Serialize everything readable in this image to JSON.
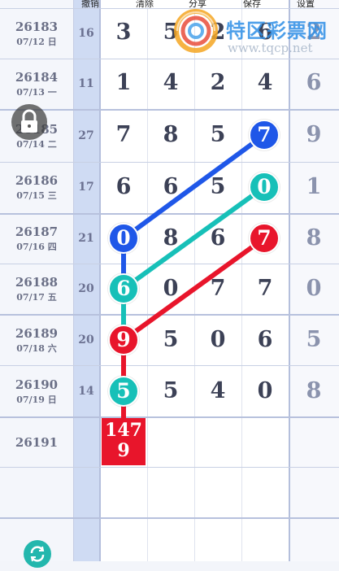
{
  "toolbar": {
    "undo_label": "撤销",
    "clear_label": "清除",
    "share_label": "分享",
    "save_label": "保存",
    "settings_label": "设置"
  },
  "watermark": {
    "title": "特区彩票网",
    "url": "www.tqcp.net"
  },
  "rows": [
    {
      "issue": "26183",
      "date": "07/12 日",
      "sum": "16",
      "digits": [
        "3",
        "5",
        "2",
        "6"
      ],
      "extra": "2"
    },
    {
      "issue": "26184",
      "date": "07/13 一",
      "sum": "11",
      "digits": [
        "1",
        "4",
        "2",
        "4"
      ],
      "extra": "6"
    },
    {
      "issue": "26185",
      "date": "07/14 二",
      "sum": "27",
      "digits": [
        "7",
        "8",
        "5",
        "7"
      ],
      "extra": "9"
    },
    {
      "issue": "26186",
      "date": "07/15 三",
      "sum": "17",
      "digits": [
        "6",
        "6",
        "5",
        "0"
      ],
      "extra": "1"
    },
    {
      "issue": "26187",
      "date": "07/16 四",
      "sum": "21",
      "digits": [
        "0",
        "8",
        "6",
        "7"
      ],
      "extra": "8"
    },
    {
      "issue": "26188",
      "date": "07/17 五",
      "sum": "20",
      "digits": [
        "6",
        "0",
        "7",
        "7"
      ],
      "extra": "0"
    },
    {
      "issue": "26189",
      "date": "07/18 六",
      "sum": "20",
      "digits": [
        "9",
        "5",
        "0",
        "6"
      ],
      "extra": "5"
    },
    {
      "issue": "26190",
      "date": "07/19 日",
      "sum": "14",
      "digits": [
        "5",
        "5",
        "4",
        "0"
      ],
      "extra": "8"
    }
  ],
  "next_issue": "26191",
  "prediction": {
    "line1": "147",
    "line2": "9"
  },
  "colors": {
    "blue": "#1f57e8",
    "teal": "#17c0b8",
    "red": "#e8152b",
    "grid_blue": "#d2dcf2"
  }
}
